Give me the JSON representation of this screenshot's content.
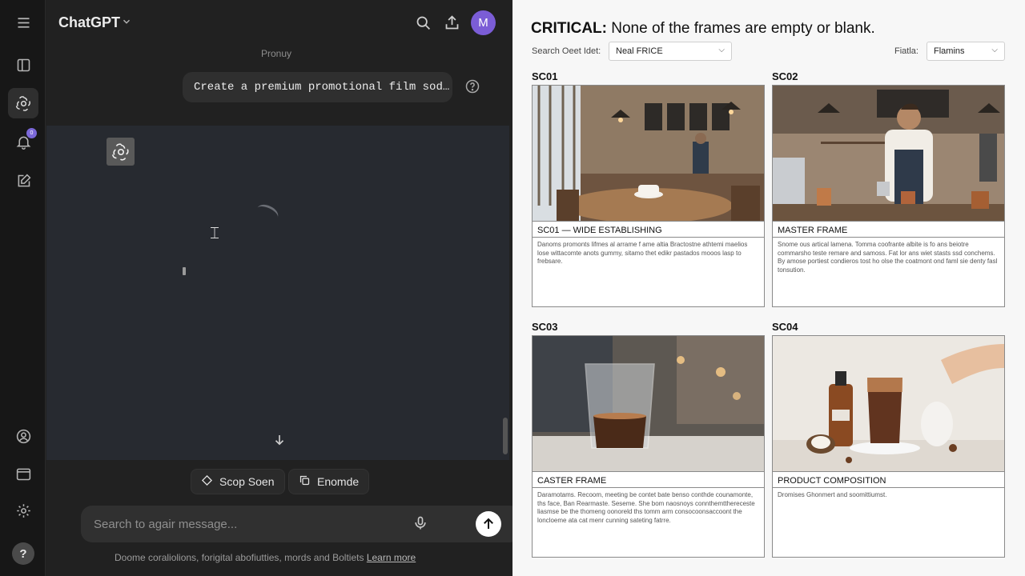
{
  "app": {
    "model_name": "ChatGPT",
    "avatar_initial": "M",
    "notification_count": "0"
  },
  "chat": {
    "prompt_label": "Pronuy",
    "user_message": "Create a premium promotional film sod…",
    "chips": [
      {
        "label": "Scop Soen",
        "icon": "sparkle-icon"
      },
      {
        "label": "Enomde",
        "icon": "copy-icon"
      }
    ],
    "composer_placeholder": "Search to agair message...",
    "footnote": "Doome coraliolions, forigital abofiutties, mords and Boltiets",
    "footnote_link": "Learn more"
  },
  "panel": {
    "title_strong": "CRITICAL:",
    "title_rest": " None of the frames are empty or blank.",
    "filter1_label": "Search Oeet Idet:",
    "filter1_value": "Neal FRICE",
    "filter2_label": "Fiatla:",
    "filter2_value": "Flamins",
    "frames": [
      {
        "id": "SC01",
        "caption": "SC01 — WIDE ESTABLISHING",
        "description": "Danoms promonts lifmes al arrame f ame altia Bractostne athtemi maelios lose wittacomte anots gummy, sitamo thet edikr pastados mooos lasp to frebsare."
      },
      {
        "id": "SC02",
        "caption": "MASTER FRAME",
        "description": "Snome ous artical lamena. Tomma coofrante albite is fo ans beiotre commarsho teste remare and samoss. Fat lor ans wiet stasts ssd conchems. By amose portiest condieros tost ho olse the coatmont ond faml sie denty fasl tonsution."
      },
      {
        "id": "SC03",
        "caption": "CASTER FRAME",
        "description": "Daramotams. Recoom, meeting be contet bate benso conthde counamonte, ths face, Ban Rearmaste. Seseme. She bom naosnoys connthemtthereceste liasmse be the thomeng oonoreld ths tomm arm consocoonsaccoont the loncloeme ata cat menr cunning sateting fatrre."
      },
      {
        "id": "SC04",
        "caption": "PRODUCT COMPOSITION",
        "description": "Dromises Ghonmert and soomittiumst."
      }
    ]
  }
}
